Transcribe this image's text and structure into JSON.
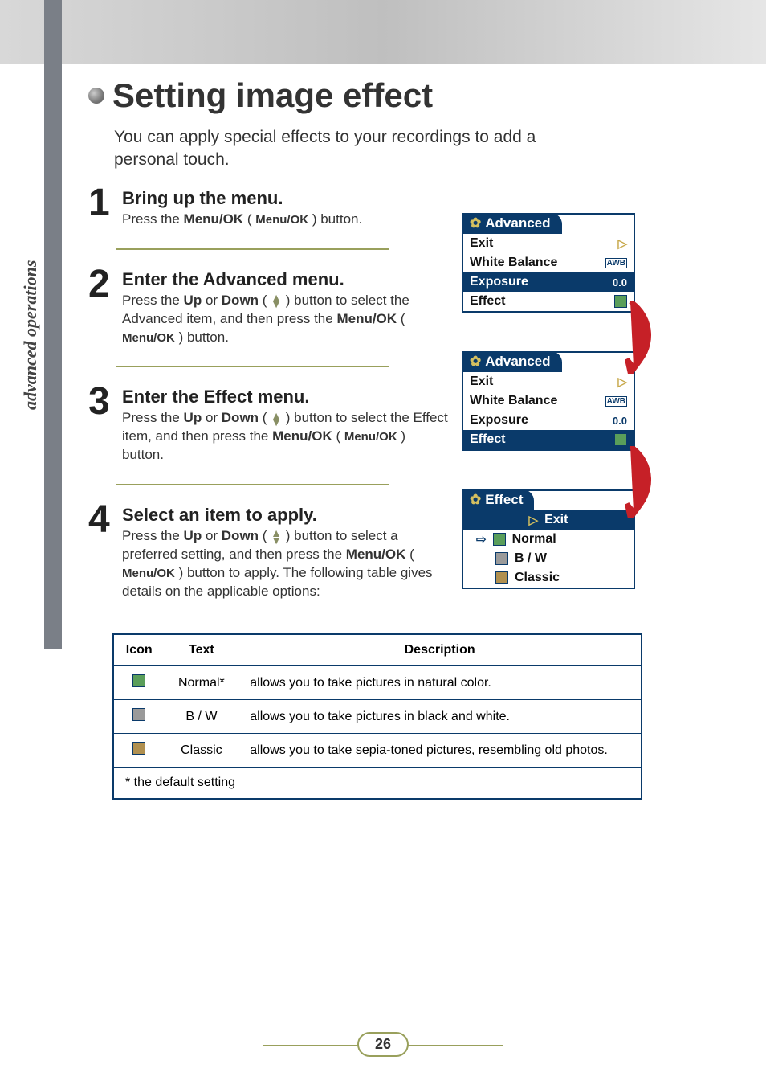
{
  "side_label": "advanced operations",
  "title": "Setting image effect",
  "intro": "You can apply special effects to your recordings to add a personal touch.",
  "steps": [
    {
      "num": "1",
      "heading": "Bring up the menu.",
      "text_pre": "Press the ",
      "menuok1": "Menu/OK",
      "text_mid": " ( ",
      "menuok2": "Menu/OK",
      "text_post": " ) button."
    },
    {
      "num": "2",
      "heading": "Enter the Advanced menu.",
      "l1a": "Press the ",
      "up": "Up",
      "l1b": " or ",
      "down": "Down",
      "l1c": " ( ",
      "l1d": " ) button to select the Advanced item, and then press the ",
      "menuok1": "Menu/OK",
      "l1e": " ( ",
      "menuok2": "Menu/OK",
      "l1f": " ) button."
    },
    {
      "num": "3",
      "heading": "Enter the Effect menu.",
      "l1a": "Press the ",
      "up": "Up",
      "l1b": " or ",
      "down": "Down",
      "l1c": " ( ",
      "l1d": " ) button to select the Effect item, and then press the ",
      "menuok1": "Menu/OK",
      "l1e": " ( ",
      "menuok2": "Menu/OK",
      "l1f": " ) button."
    },
    {
      "num": "4",
      "heading": "Select an item to apply.",
      "l1a": "Press the ",
      "up": "Up",
      "l1b": " or ",
      "down": "Down",
      "l1c": " ( ",
      "l1d": " ) button to select a preferred setting, and then press the ",
      "menuok1": "Menu/OK",
      "l1e": " ( ",
      "menuok2": "Menu/OK",
      "l1f": " ) button to apply. The following table gives details on the applicable options:"
    }
  ],
  "menus": {
    "m1": {
      "tab": "Advanced",
      "rows": [
        {
          "label": "Exit",
          "icon": "exit"
        },
        {
          "label": "White Balance",
          "icon": "awb"
        },
        {
          "label": "Exposure",
          "value": "0.0",
          "selected": true
        },
        {
          "label": "Effect",
          "icon": "effect-green"
        }
      ]
    },
    "m2": {
      "tab": "Advanced",
      "rows": [
        {
          "label": "Exit",
          "icon": "exit"
        },
        {
          "label": "White Balance",
          "icon": "awb"
        },
        {
          "label": "Exposure",
          "value": "0.0"
        },
        {
          "label": "Effect",
          "icon": "effect-green",
          "selected": true
        }
      ]
    },
    "m3": {
      "tab": "Effect",
      "items": [
        {
          "label": "Exit",
          "icon": "exit",
          "subtab": true
        },
        {
          "label": "Normal",
          "icon": "effect-green",
          "selected": true
        },
        {
          "label": "B / W",
          "icon": "effect-grey"
        },
        {
          "label": "Classic",
          "icon": "effect-sepia"
        }
      ]
    }
  },
  "table": {
    "headers": [
      "Icon",
      "Text",
      "Description"
    ],
    "rows": [
      {
        "icon": "effect-green",
        "text": "Normal*",
        "desc": "allows you to take pictures in natural color."
      },
      {
        "icon": "effect-grey",
        "text": "B / W",
        "desc": "allows you to take pictures in black and white."
      },
      {
        "icon": "effect-sepia",
        "text": "Classic",
        "desc": "allows you to take sepia-toned pictures, resembling old photos."
      }
    ],
    "footnote": "* the default setting"
  },
  "page_number": "26"
}
